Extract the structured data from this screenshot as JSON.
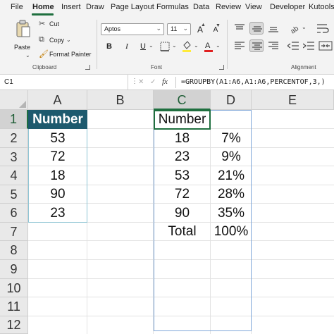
{
  "menu": {
    "tabs": [
      "File",
      "Home",
      "Insert",
      "Draw",
      "Page Layout",
      "Formulas",
      "Data",
      "Review",
      "View",
      "Developer",
      "Kutools"
    ],
    "active": "Home"
  },
  "ribbon": {
    "clipboard": {
      "paste_label": "Paste",
      "cut_label": "Cut",
      "copy_label": "Copy",
      "format_painter_label": "Format Painter",
      "group_label": "Clipboard"
    },
    "font": {
      "font_name": "Aptos",
      "font_size": "11",
      "bold": "B",
      "italic": "I",
      "underline": "U",
      "grow": "A",
      "shrink": "A",
      "group_label": "Font"
    },
    "alignment": {
      "group_label": "Alignment"
    }
  },
  "formula_bar": {
    "name_box": "C1",
    "cancel_icon": "✕",
    "enter_icon": "✓",
    "fx_label": "fx",
    "formula": "=GROUPBY(A1:A6,A1:A6,PERCENTOF,3,)"
  },
  "grid": {
    "columns": [
      "A",
      "B",
      "C",
      "D",
      "E"
    ],
    "selected_column": "C",
    "rows": [
      "1",
      "2",
      "3",
      "4",
      "5",
      "6",
      "7",
      "8",
      "9",
      "10",
      "11",
      "12"
    ],
    "selected_row": "1",
    "column_a": [
      "Number",
      "53",
      "72",
      "18",
      "90",
      "23"
    ],
    "spill_header": "Number",
    "spill_rows": [
      {
        "c": "18",
        "d": "7%"
      },
      {
        "c": "23",
        "d": "9%"
      },
      {
        "c": "53",
        "d": "21%"
      },
      {
        "c": "72",
        "d": "28%"
      },
      {
        "c": "90",
        "d": "35%"
      },
      {
        "c": "Total",
        "d": "100%"
      }
    ]
  },
  "colors": {
    "accent": "#1f6f3f",
    "header_fill": "#1d5a6e"
  }
}
